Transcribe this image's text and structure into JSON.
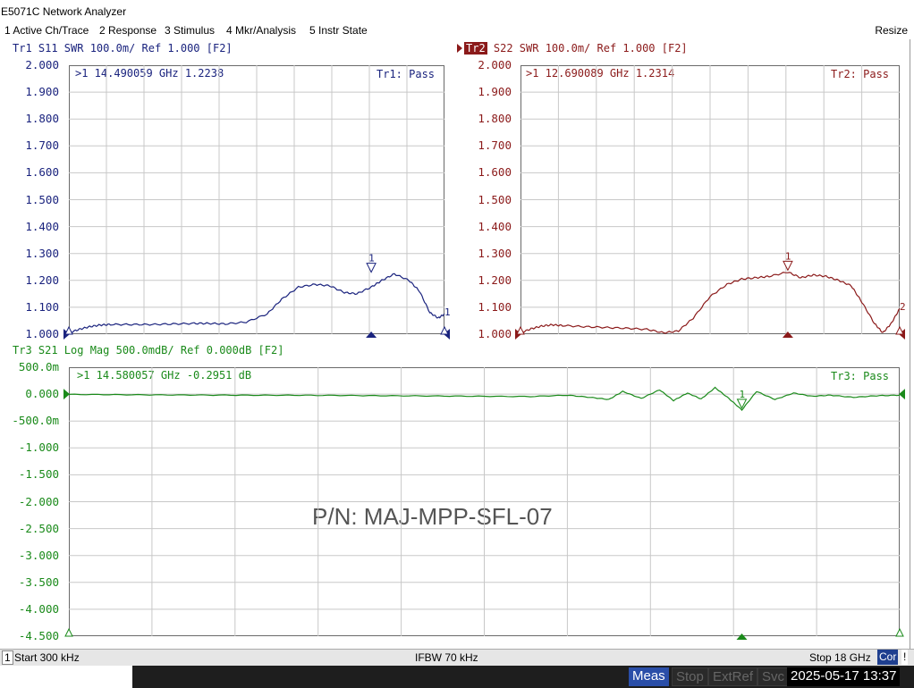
{
  "window": {
    "title": "E5071C Network Analyzer"
  },
  "menu": {
    "items": [
      "1 Active Ch/Trace",
      "2 Response",
      "3 Stimulus",
      "4 Mkr/Analysis",
      "5 Instr State"
    ],
    "resize": "Resize"
  },
  "colors": {
    "tr1": "#1a237e",
    "tr2": "#8b1a1a",
    "tr3": "#1a8a1a",
    "grid": "#c8c8c8"
  },
  "watermark": "P/N: MAJ-MPP-SFL-07",
  "traces": {
    "tr1": {
      "title": "Tr1 S11 SWR 100.0m/ Ref 1.000 [F2]",
      "marker_readout": ">1  14.490059 GHz  1.2238",
      "status": "Tr1: Pass",
      "marker_label": "1"
    },
    "tr2": {
      "title_tag": "Tr2",
      "title_rest": " S22 SWR 100.0m/ Ref 1.000 [F2]",
      "marker_readout": ">1  12.690089 GHz  1.2314",
      "status": "Tr2: Pass",
      "marker_label": "1",
      "marker2_label": "2"
    },
    "tr3": {
      "title": "Tr3 S21 Log Mag 500.0mdB/ Ref 0.000dB [F2]",
      "marker_readout": ">1  14.580057 GHz -0.2951 dB",
      "status": "Tr3: Pass",
      "marker_label": "1"
    }
  },
  "chart_data": [
    {
      "type": "line",
      "title": "Tr1 S11 SWR 100.0m/ Ref 1.000 [F2]",
      "yticks": [
        "2.000",
        "1.900",
        "1.800",
        "1.700",
        "1.600",
        "1.500",
        "1.400",
        "1.300",
        "1.200",
        "1.100",
        "1.000"
      ],
      "ylim": [
        1.0,
        2.0
      ],
      "xlim": [
        0.0003,
        18
      ],
      "x_unit": "GHz",
      "grid": true,
      "series": [
        {
          "x": [
            0.0003,
            0.5,
            1.0,
            1.5,
            2.0,
            3.0,
            4.0,
            5.0,
            6.0,
            6.7,
            7.5,
            8.5,
            9.5,
            10.2,
            11.0,
            11.8,
            12.5,
            13.2,
            13.8,
            14.49,
            15.0,
            15.6,
            16.3,
            16.8,
            17.3,
            17.7,
            18.0
          ],
          "values": [
            1.005,
            1.018,
            1.028,
            1.034,
            1.036,
            1.036,
            1.036,
            1.038,
            1.04,
            1.04,
            1.038,
            1.045,
            1.075,
            1.13,
            1.175,
            1.185,
            1.18,
            1.155,
            1.15,
            1.175,
            1.2,
            1.224,
            1.2,
            1.16,
            1.08,
            1.06,
            1.075
          ]
        }
      ],
      "marker": {
        "x": 14.49,
        "y": 1.2238
      }
    },
    {
      "type": "line",
      "title": "Tr2 S22 SWR 100.0m/ Ref 1.000 [F2]",
      "yticks": [
        "2.000",
        "1.900",
        "1.800",
        "1.700",
        "1.600",
        "1.500",
        "1.400",
        "1.300",
        "1.200",
        "1.100",
        "1.000"
      ],
      "ylim": [
        1.0,
        2.0
      ],
      "xlim": [
        0.0003,
        18
      ],
      "x_unit": "GHz",
      "grid": true,
      "series": [
        {
          "x": [
            0.0003,
            0.5,
            1.0,
            1.5,
            2.0,
            3.0,
            4.0,
            5.0,
            6.0,
            6.8,
            7.5,
            8.2,
            9.0,
            9.8,
            10.5,
            11.2,
            11.8,
            12.69,
            13.3,
            13.9,
            14.5,
            15.1,
            15.7,
            16.2,
            16.8,
            17.2,
            17.6,
            18.0
          ],
          "values": [
            1.005,
            1.02,
            1.03,
            1.035,
            1.032,
            1.028,
            1.025,
            1.022,
            1.018,
            1.005,
            1.012,
            1.06,
            1.14,
            1.185,
            1.205,
            1.21,
            1.215,
            1.231,
            1.21,
            1.22,
            1.215,
            1.2,
            1.18,
            1.12,
            1.04,
            1.005,
            1.04,
            1.095
          ]
        }
      ],
      "marker": {
        "x": 12.69,
        "y": 1.2314
      }
    },
    {
      "type": "line",
      "title": "Tr3 S21 Log Mag 500.0mdB/ Ref 0.000dB [F2]",
      "yticks": [
        "500.0m",
        "0.000",
        "-500.0m",
        "-1.000",
        "-1.500",
        "-2.000",
        "-2.500",
        "-3.000",
        "-3.500",
        "-4.000",
        "-4.500"
      ],
      "ylim": [
        -4.5,
        0.5
      ],
      "xlim": [
        0.0003,
        18
      ],
      "x_unit": "dB",
      "grid": true,
      "series": [
        {
          "x": [
            0.0003,
            1.0,
            2.0,
            3.0,
            4.0,
            5.0,
            6.0,
            7.0,
            8.0,
            9.0,
            10.0,
            10.8,
            11.3,
            11.7,
            12.0,
            12.4,
            12.8,
            13.1,
            13.4,
            13.7,
            14.0,
            14.3,
            14.58,
            14.9,
            15.3,
            15.7,
            16.1,
            16.5,
            17.0,
            17.5,
            18.0
          ],
          "values": [
            -0.005,
            -0.01,
            -0.015,
            -0.018,
            -0.02,
            -0.022,
            -0.025,
            -0.03,
            -0.035,
            -0.04,
            -0.045,
            -0.02,
            -0.06,
            -0.1,
            0.05,
            -0.08,
            0.08,
            -0.12,
            0.02,
            -0.09,
            0.12,
            -0.08,
            -0.295,
            0.05,
            -0.1,
            0.02,
            -0.04,
            -0.02,
            -0.06,
            -0.03,
            -0.02
          ]
        }
      ],
      "marker": {
        "x": 14.58,
        "y": -0.2951
      }
    }
  ],
  "status": {
    "channel": "1",
    "start": "Start 300 kHz",
    "ifbw": "IFBW 70 kHz",
    "stop": "Stop 18 GHz",
    "cor": "Cor",
    "alert": "!"
  },
  "bottom": {
    "meas": "Meas",
    "stop": "Stop",
    "extref": "ExtRef",
    "svc": "Svc",
    "datetime": "2025-05-17 13:37"
  }
}
